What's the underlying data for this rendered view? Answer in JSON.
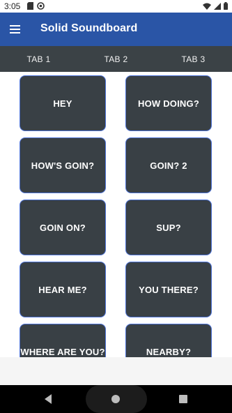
{
  "status_bar": {
    "time": "3:05",
    "icons": [
      "sd-card-icon",
      "at-sign-icon",
      "wifi-icon",
      "signal-icon",
      "battery-icon"
    ]
  },
  "app_bar": {
    "title": "Solid Soundboard",
    "menu_icon": "hamburger-menu-icon"
  },
  "tabs": [
    {
      "label": "TAB 1",
      "selected": true
    },
    {
      "label": "TAB 2",
      "selected": false
    },
    {
      "label": "TAB 3",
      "selected": false
    }
  ],
  "sound_buttons": [
    "HEY",
    "HOW DOING?",
    "HOW'S GOIN?",
    "GOIN? 2",
    "GOIN ON?",
    "SUP?",
    "HEAR ME?",
    "YOU THERE?",
    "WHERE ARE YOU?",
    "NEARBY?"
  ],
  "colors": {
    "app_bar": "#2a55a6",
    "tab_bar": "#3b4246",
    "button_fill": "#394045",
    "button_border": "#4d73d9"
  },
  "nav_bar": {
    "icons": [
      "back-icon",
      "home-icon",
      "recents-icon"
    ]
  }
}
